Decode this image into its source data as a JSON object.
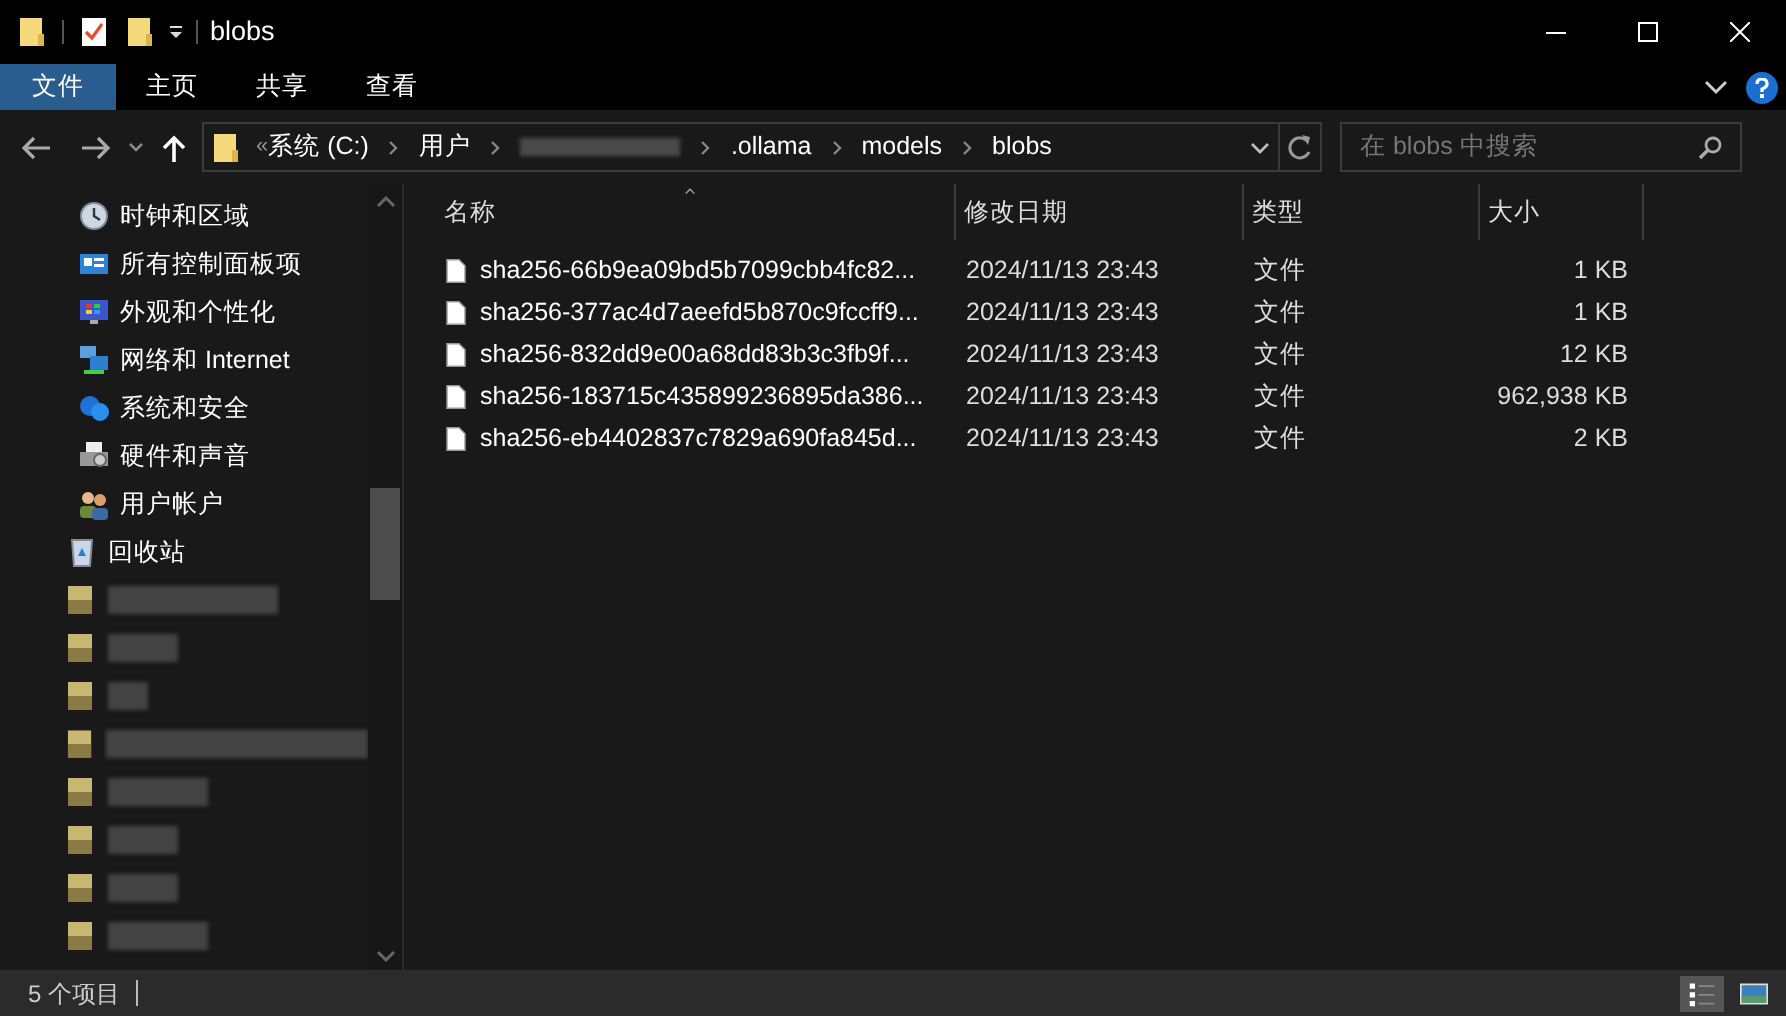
{
  "window": {
    "title": "blobs"
  },
  "ribbon_tabs": [
    {
      "label": "文件",
      "selected": true
    },
    {
      "label": "主页",
      "selected": false
    },
    {
      "label": "共享",
      "selected": false
    },
    {
      "label": "查看",
      "selected": false
    }
  ],
  "address_bar": {
    "overflow": "«",
    "segments": [
      {
        "kind": "text",
        "label": "系统 (C:)"
      },
      {
        "kind": "text",
        "label": "用户"
      },
      {
        "kind": "redacted"
      },
      {
        "kind": "text",
        "label": ".ollama"
      },
      {
        "kind": "text",
        "label": "models"
      },
      {
        "kind": "text",
        "label": "blobs"
      }
    ]
  },
  "search": {
    "placeholder": "在 blobs 中搜索"
  },
  "nav_pane": {
    "control_panel_items": [
      {
        "label": "时钟和区域"
      },
      {
        "label": "所有控制面板项"
      },
      {
        "label": "外观和个性化"
      },
      {
        "label": "网络和 Internet"
      },
      {
        "label": "系统和安全"
      },
      {
        "label": "硬件和声音"
      },
      {
        "label": "用户帐户"
      }
    ],
    "items": [
      {
        "kind": "recycle",
        "label": "回收站"
      },
      {
        "kind": "redacted"
      },
      {
        "kind": "redacted"
      },
      {
        "kind": "redacted"
      },
      {
        "kind": "redacted"
      },
      {
        "kind": "redacted"
      },
      {
        "kind": "redacted"
      },
      {
        "kind": "redacted"
      },
      {
        "kind": "redacted"
      }
    ]
  },
  "table": {
    "columns": [
      {
        "label": "名称",
        "sorted": true
      },
      {
        "label": "修改日期",
        "sorted": false
      },
      {
        "label": "类型",
        "sorted": false
      },
      {
        "label": "大小",
        "sorted": false
      }
    ],
    "rows": [
      {
        "name": "sha256-66b9ea09bd5b7099cbb4fc82...",
        "date": "2024/11/13 23:43",
        "type": "文件",
        "size": "1 KB"
      },
      {
        "name": "sha256-377ac4d7aeefd5b870c9fccff9...",
        "date": "2024/11/13 23:43",
        "type": "文件",
        "size": "1 KB"
      },
      {
        "name": "sha256-832dd9e00a68dd83b3c3fb9f...",
        "date": "2024/11/13 23:43",
        "type": "文件",
        "size": "12 KB"
      },
      {
        "name": "sha256-183715c435899236895da386...",
        "date": "2024/11/13 23:43",
        "type": "文件",
        "size": "962,938 KB"
      },
      {
        "name": "sha256-eb4402837c7829a690fa845d...",
        "date": "2024/11/13 23:43",
        "type": "文件",
        "size": "2 KB"
      }
    ]
  },
  "status_bar": {
    "item_count": "5 个项目",
    "views": [
      {
        "kind": "details",
        "selected": true
      },
      {
        "kind": "thumbnails",
        "selected": false
      }
    ]
  }
}
